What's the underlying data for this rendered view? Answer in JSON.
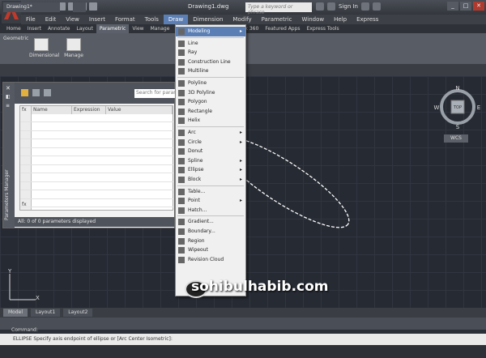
{
  "title": "Drawing1.dwg",
  "search_placeholder": "Type a keyword or phrase",
  "signin_label": "Sign In",
  "window_buttons": [
    "_",
    "□",
    "✕"
  ],
  "menubar": [
    "File",
    "Edit",
    "View",
    "Insert",
    "Format",
    "Tools",
    "Draw",
    "Dimension",
    "Modify",
    "Parametric",
    "Window",
    "Help",
    "Express"
  ],
  "ribbon_tabs": [
    "Home",
    "Insert",
    "Annotate",
    "Layout",
    "Parametric",
    "View",
    "Manage",
    "Output",
    "Plug-ins",
    "Autodesk 360",
    "Featured Apps",
    "Express Tools"
  ],
  "ribbon": {
    "group_label": "Geometric",
    "tools": [
      "Dimensional",
      "Manage"
    ]
  },
  "doc_tab": "Drawing1*",
  "parameters_manager": {
    "side_label": "Parameters Manager",
    "search_placeholder": "Search for parameter",
    "columns": [
      "Name",
      "Expression",
      "Value"
    ],
    "row_numbers": [
      "fx",
      "fx"
    ],
    "status": "All: 0 of 0 parameters displayed"
  },
  "draw_menu": [
    {
      "label": "Modeling",
      "submenu": true,
      "highlight": true
    },
    {
      "sep": true
    },
    {
      "label": "Line"
    },
    {
      "label": "Ray"
    },
    {
      "label": "Construction Line"
    },
    {
      "label": "Multiline"
    },
    {
      "sep": true
    },
    {
      "label": "Polyline"
    },
    {
      "label": "3D Polyline"
    },
    {
      "label": "Polygon"
    },
    {
      "label": "Rectangle"
    },
    {
      "label": "Helix"
    },
    {
      "sep": true
    },
    {
      "label": "Arc",
      "submenu": true
    },
    {
      "label": "Circle",
      "submenu": true
    },
    {
      "label": "Donut"
    },
    {
      "label": "Spline",
      "submenu": true
    },
    {
      "label": "Ellipse",
      "submenu": true
    },
    {
      "label": "Block",
      "submenu": true
    },
    {
      "sep": true
    },
    {
      "label": "Table..."
    },
    {
      "label": "Point",
      "submenu": true
    },
    {
      "label": "Hatch..."
    },
    {
      "sep": true
    },
    {
      "label": "Gradient..."
    },
    {
      "label": "Boundary..."
    },
    {
      "label": "Region"
    },
    {
      "label": "Wipeout"
    },
    {
      "label": "Revision Cloud"
    }
  ],
  "viewcube": {
    "N": "N",
    "S": "S",
    "E": "E",
    "W": "W",
    "top": "TOP",
    "wcs": "WCS"
  },
  "ucs": {
    "y": "Y",
    "x": "X"
  },
  "layout_tabs": [
    "Model",
    "Layout1",
    "Layout2"
  ],
  "command": {
    "label": "Command:",
    "line": "ELLIPSE Specify axis endpoint of ellipse or [Arc Center Isometric]:"
  },
  "watermark": "sohibulhabib.com",
  "colors": {
    "canvas": "#262a33",
    "menu_highlight": "#5b7fb5",
    "ellipse": "#ffffff"
  }
}
